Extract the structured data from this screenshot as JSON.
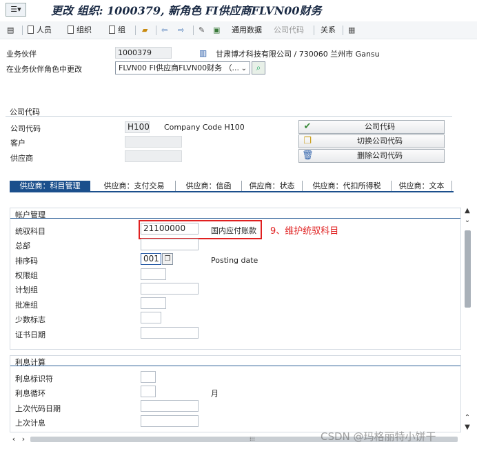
{
  "title": "更改 组织: 1000379, 新角色 FI供应商FLVN00财务",
  "toolbar": {
    "person": "人员",
    "org": "组织",
    "group": "组",
    "general_data": "通用数据",
    "company_code": "公司代码",
    "relations": "关系"
  },
  "header": {
    "bp_label": "业务伙伴",
    "bp_value": "1000379",
    "bp_desc": "甘肃博才科技有限公司 / 730060 兰州市 Gansu",
    "role_label": "在业务伙伴角色中更改",
    "role_value": "FLVN00 FI供应商FLVN00财务 （..."
  },
  "company_code_section": {
    "title": "公司代码",
    "cc_label": "公司代码",
    "cc_value": "H100",
    "cc_desc": "Company Code H100",
    "customer_label": "客户",
    "vendor_label": "供应商",
    "buttons": {
      "company_code": "公司代码",
      "switch": "切换公司代码",
      "delete": "删除公司代码"
    }
  },
  "tabs": [
    "供应商：科目管理",
    "供应商：支付交易",
    "供应商：信函",
    "供应商：状态",
    "供应商：代扣所得税",
    "供应商：文本"
  ],
  "account_mgmt": {
    "title": "帐户管理",
    "recon_label": "统驭科目",
    "recon_value": "21100000",
    "recon_desc": "国内应付账款",
    "head_office_label": "总部",
    "sort_key_label": "排序码",
    "sort_key_value": "001",
    "sort_key_desc": "Posting date",
    "auth_group_label": "权限组",
    "plan_group_label": "计划组",
    "release_group_label": "批准组",
    "minority_label": "少数标志",
    "cert_date_label": "证书日期"
  },
  "annotation": "9、维护统驭科目",
  "interest": {
    "title": "利息计算",
    "indicator_label": "利息标识符",
    "cycle_label": "利息循环",
    "cycle_unit": "月",
    "last_key_date_label": "上次代码日期",
    "last_calc_label": "上次计息"
  },
  "watermark": "CSDN @玛格丽特小饼干"
}
